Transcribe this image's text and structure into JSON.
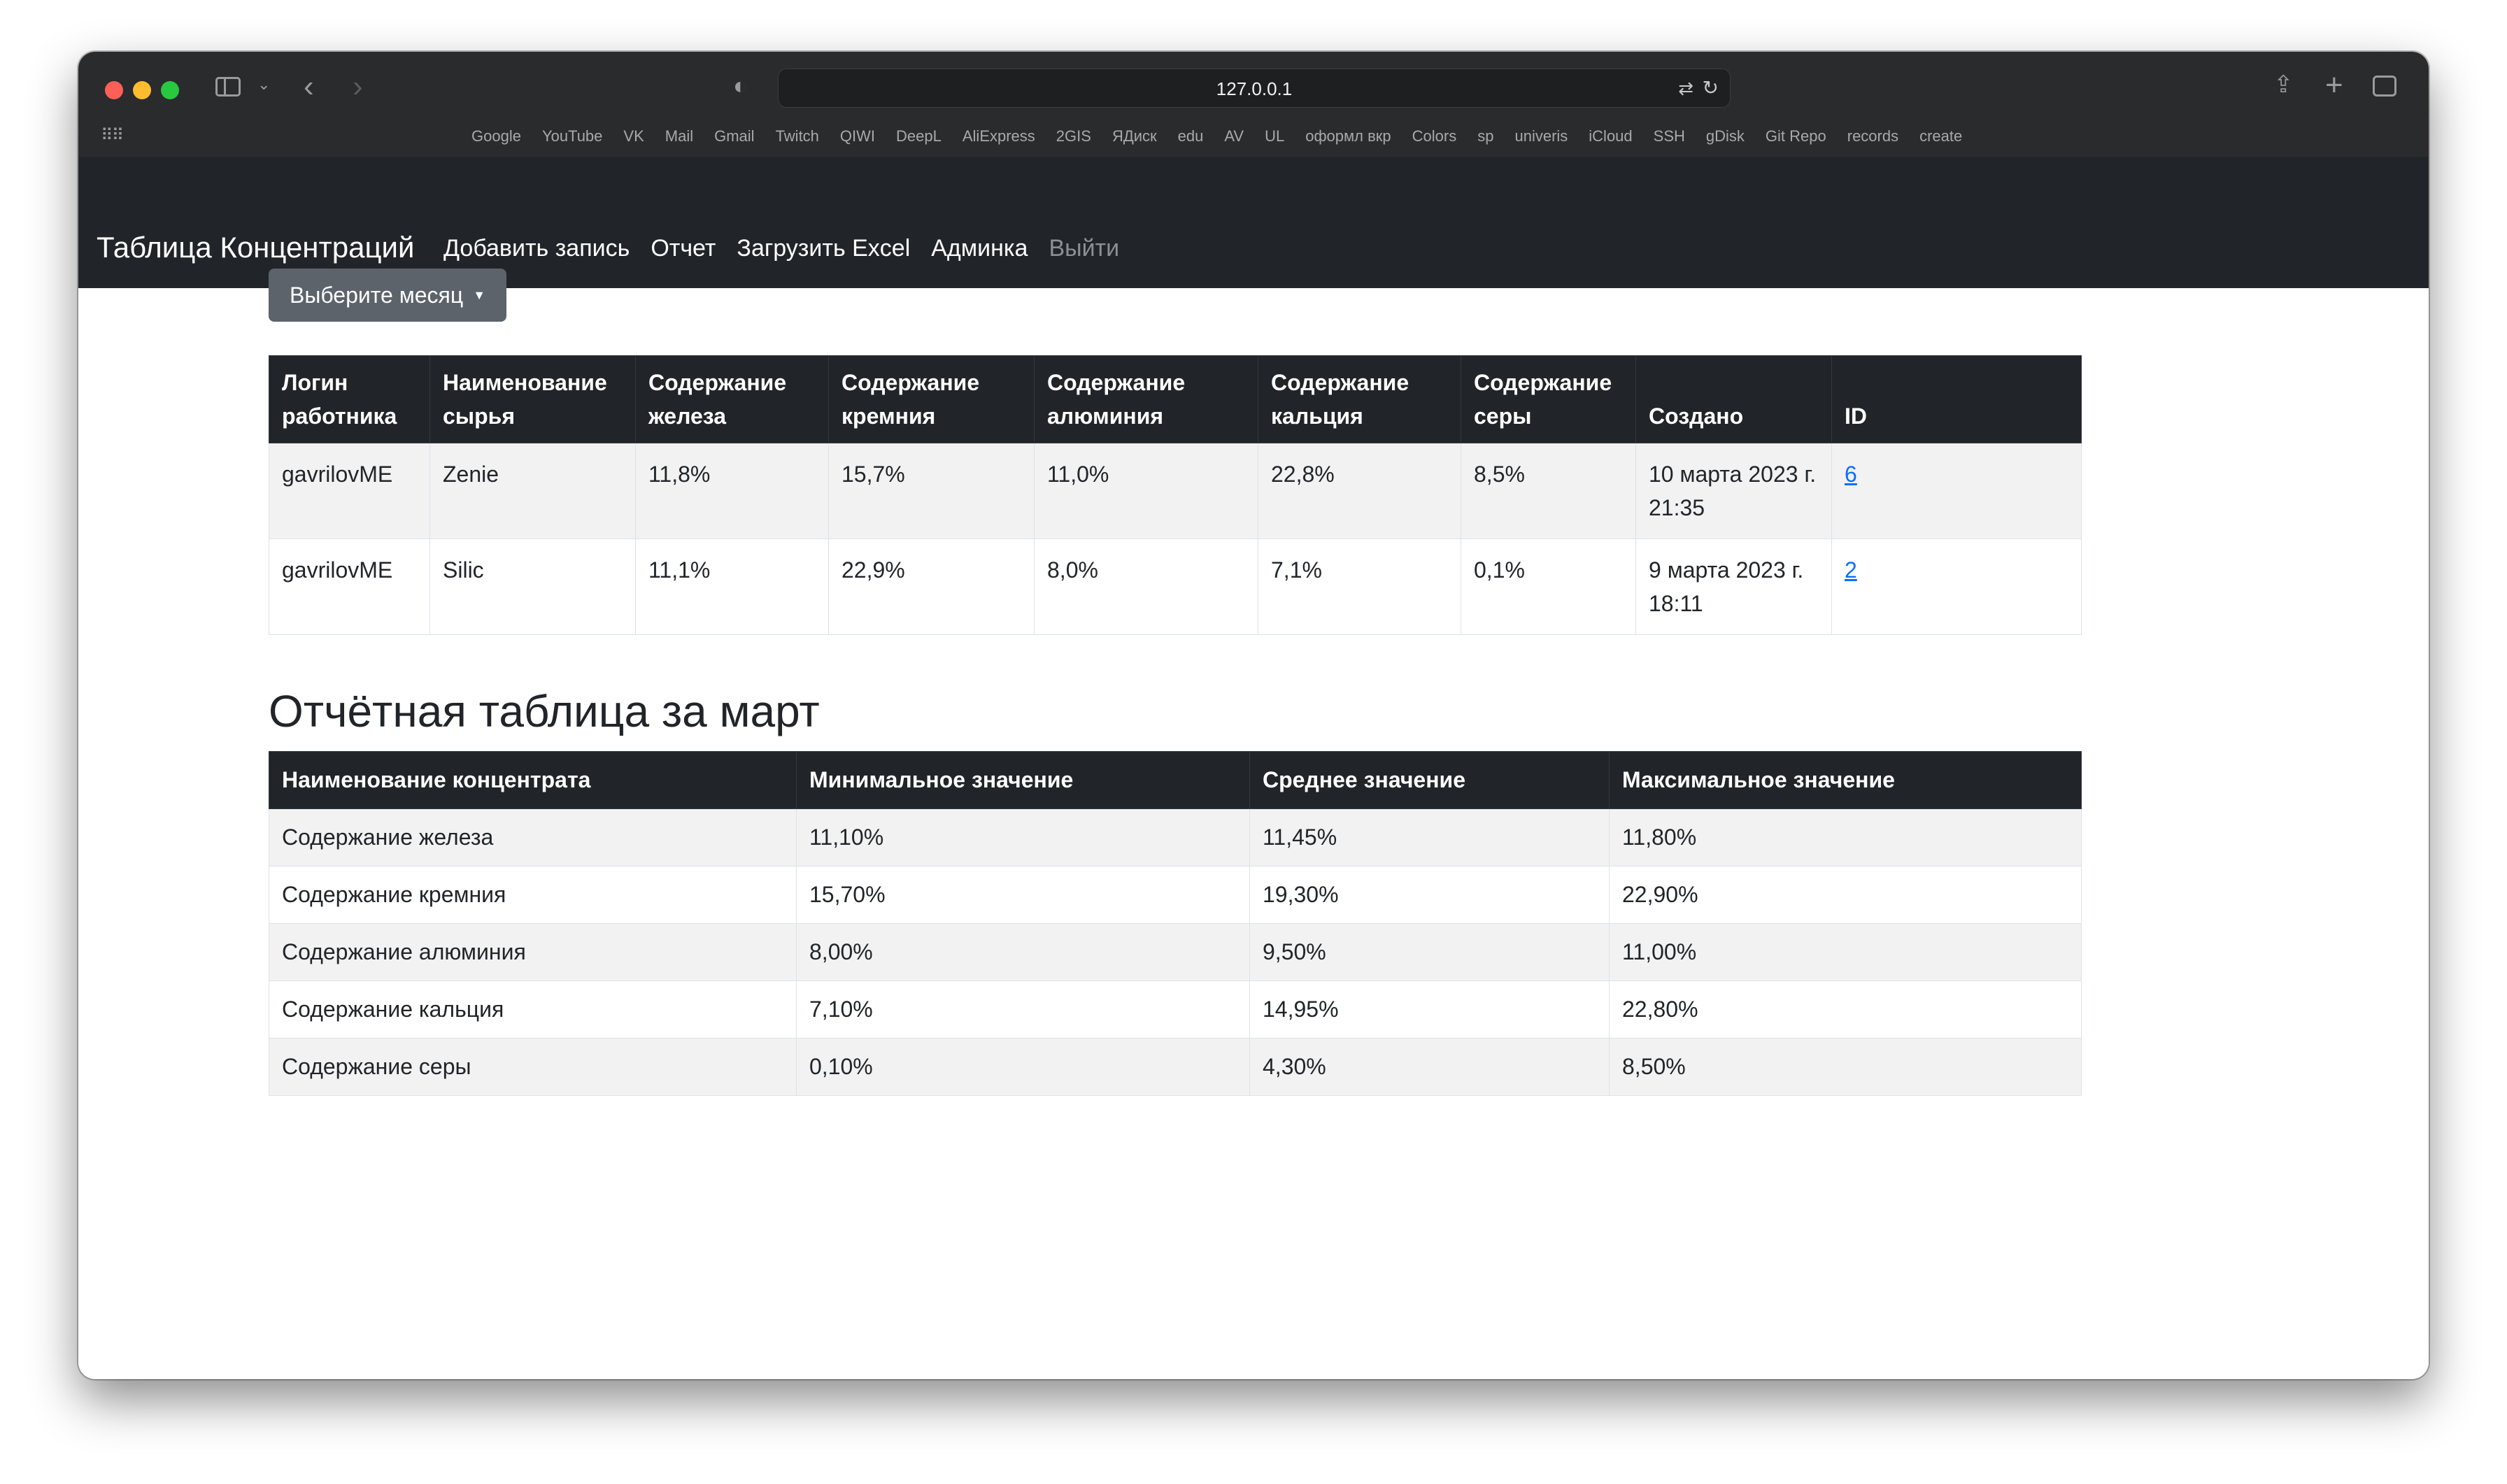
{
  "browser": {
    "url": "127.0.0.1",
    "bookmarks": [
      "Google",
      "YouTube",
      "VK",
      "Mail",
      "Gmail",
      "Twitch",
      "QIWI",
      "DeepL",
      "AliExpress",
      "2GIS",
      "ЯДиск",
      "edu",
      "AV",
      "UL",
      "оформл вкр",
      "Colors",
      "sp",
      "univeris",
      "iCloud",
      "SSH",
      "gDisk",
      "Git Repo",
      "records",
      "create"
    ]
  },
  "navbar": {
    "brand": "Таблица Концентраций",
    "links": [
      "Добавить запись",
      "Отчет",
      "Загрузить Excel",
      "Админка",
      "Выйти"
    ]
  },
  "month_button": "Выберите месяц",
  "records_table": {
    "headers": [
      "Логин работника",
      "Наименование сырья",
      "Содержание железа",
      "Содержание кремния",
      "Содержание алюминия",
      "Содержание кальция",
      "Содержание серы",
      "Создано",
      "ID"
    ],
    "rows": [
      [
        "gavrilovME",
        "Zenie",
        "11,8%",
        "15,7%",
        "11,0%",
        "22,8%",
        "8,5%",
        "10 марта 2023 г. 21:35",
        "6"
      ],
      [
        "gavrilovME",
        "Silic",
        "11,1%",
        "22,9%",
        "8,0%",
        "7,1%",
        "0,1%",
        "9 марта 2023 г. 18:11",
        "2"
      ]
    ]
  },
  "report": {
    "title": "Отчётная таблица за март",
    "headers": [
      "Наименование концентрата",
      "Минимальное значение",
      "Среднее значение",
      "Максимальное значение"
    ],
    "rows": [
      [
        "Содержание железа",
        "11,10%",
        "11,45%",
        "11,80%"
      ],
      [
        "Содержание кремния",
        "15,70%",
        "19,30%",
        "22,90%"
      ],
      [
        "Содержание алюминия",
        "8,00%",
        "9,50%",
        "11,00%"
      ],
      [
        "Содержание кальция",
        "7,10%",
        "14,95%",
        "22,80%"
      ],
      [
        "Содержание серы",
        "0,10%",
        "4,30%",
        "8,50%"
      ]
    ]
  }
}
